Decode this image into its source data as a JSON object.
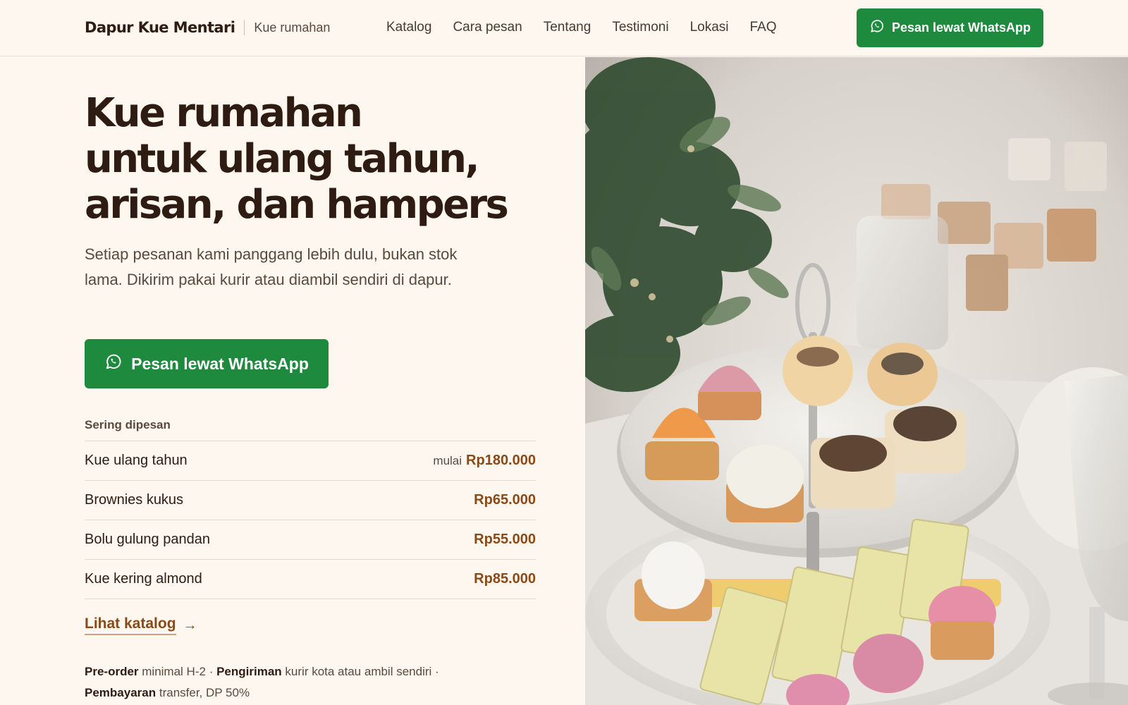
{
  "header": {
    "brand_name": "Dapur Kue Mentari",
    "brand_tagline": "Kue rumahan",
    "nav": [
      "Katalog",
      "Cara pesan",
      "Tentang",
      "Testimoni",
      "Lokasi",
      "FAQ"
    ],
    "cta_label": "Pesan lewat WhatsApp"
  },
  "hero": {
    "title_lines": [
      "Kue rumahan",
      "untuk ulang tahun,",
      "arisan, dan hampers"
    ],
    "subtitle": "Setiap pesanan kami panggang lebih dulu, bukan stok lama. Dikirim pakai kurir atau diambil sendiri di dapur.",
    "cta_label": "Pesan lewat WhatsApp"
  },
  "popular": {
    "label": "Sering dipesan",
    "items": [
      {
        "name": "Kue ulang tahun",
        "prefix": "mulai",
        "price": "Rp180.000"
      },
      {
        "name": "Brownies kukus",
        "prefix": "",
        "price": "Rp65.000"
      },
      {
        "name": "Bolu gulung pandan",
        "prefix": "",
        "price": "Rp55.000"
      },
      {
        "name": "Kue kering almond",
        "prefix": "",
        "price": "Rp85.000"
      }
    ],
    "catalog_link": "Lihat katalog"
  },
  "info": {
    "preorder_label": "Pre-order",
    "preorder_text": "minimal H-2",
    "delivery_label": "Pengiriman",
    "delivery_text": "kurir kota atau ambil sendiri",
    "payment_label": "Pembayaran",
    "payment_text": "transfer, DP 50%",
    "separator": "·"
  },
  "colors": {
    "background": "#fdf7ef",
    "primary_green": "#1e8a3e",
    "price_brown": "#8a4a18",
    "heading": "#2e1c12"
  },
  "icons": {
    "whatsapp": "whatsapp-icon",
    "arrow": "arrow-right-icon"
  }
}
